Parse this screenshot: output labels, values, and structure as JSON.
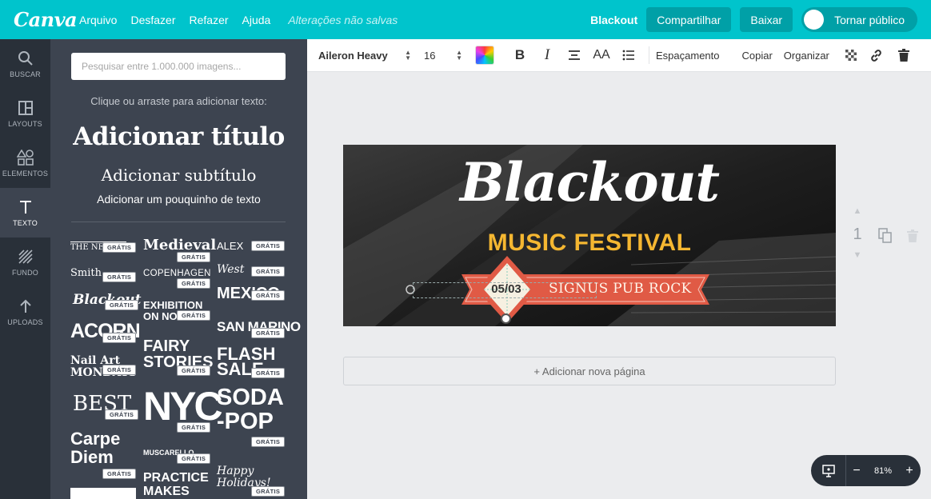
{
  "topbar": {
    "logo": "Canva",
    "menu": [
      "Arquivo",
      "Desfazer",
      "Refazer",
      "Ajuda"
    ],
    "status": "Alterações não salvas",
    "doc_title": "Blackout",
    "share_label": "Compartilhar",
    "download_label": "Baixar",
    "publish_label": "Tornar público",
    "accent_color": "#00c4cc"
  },
  "leftnav": {
    "items": [
      {
        "label": "BUSCAR",
        "icon": "search-icon"
      },
      {
        "label": "LAYOUTS",
        "icon": "layouts-icon"
      },
      {
        "label": "ELEMENTOS",
        "icon": "elements-icon"
      },
      {
        "label": "TEXTO",
        "icon": "text-icon",
        "active": true
      },
      {
        "label": "FUNDO",
        "icon": "background-icon"
      },
      {
        "label": "UPLOADS",
        "icon": "upload-icon"
      }
    ]
  },
  "panel": {
    "search_placeholder": "Pesquisar entre 1.000.000 imagens...",
    "hint": "Clique ou arraste para adicionar texto:",
    "add_title": "Adicionar título",
    "add_subtitle": "Adicionar subtítulo",
    "add_body": "Adicionar um pouquinho de texto",
    "badge": "GRÁTIS",
    "templates": [
      {
        "text": "THE NE"
      },
      {
        "text": "Medieval"
      },
      {
        "text": "ALEX"
      },
      {
        "text": "Smith"
      },
      {
        "text": "COPENHAGEN"
      },
      {
        "text": "West"
      },
      {
        "text": "Blackout"
      },
      {
        "text": "EXHIBITION ON NOW"
      },
      {
        "text": "MEXICO"
      },
      {
        "text": "ACORN"
      },
      {
        "text": "FAIRY STORIES"
      },
      {
        "text": "SAN MARINO"
      },
      {
        "text": "Nail Art MONDAYS"
      },
      {
        "text": "FLASH SALE"
      },
      {
        "text": "BEST"
      },
      {
        "text": "NYC"
      },
      {
        "text": "SODA -POP"
      },
      {
        "text": "Carpe Diem"
      },
      {
        "text": "MUSCARELLO"
      },
      {
        "text": "Happy Holidays!"
      },
      {
        "text": "PRACTICE MAKES"
      }
    ]
  },
  "toolbar": {
    "font": "Aileron Heavy",
    "size": "16",
    "spacing_label": "Espaçamento",
    "copy_label": "Copiar",
    "arrange_label": "Organizar"
  },
  "design": {
    "title": "Blackout",
    "subtitle": "MUSIC FESTIVAL",
    "date": "05/03",
    "ribbon_text": "SIGNUS PUB ROCK",
    "accent_yellow": "#f5b731",
    "ribbon_red": "#e05a45"
  },
  "add_page_label": "+ Adicionar nova página",
  "page_number": "1",
  "zoom": "81%"
}
